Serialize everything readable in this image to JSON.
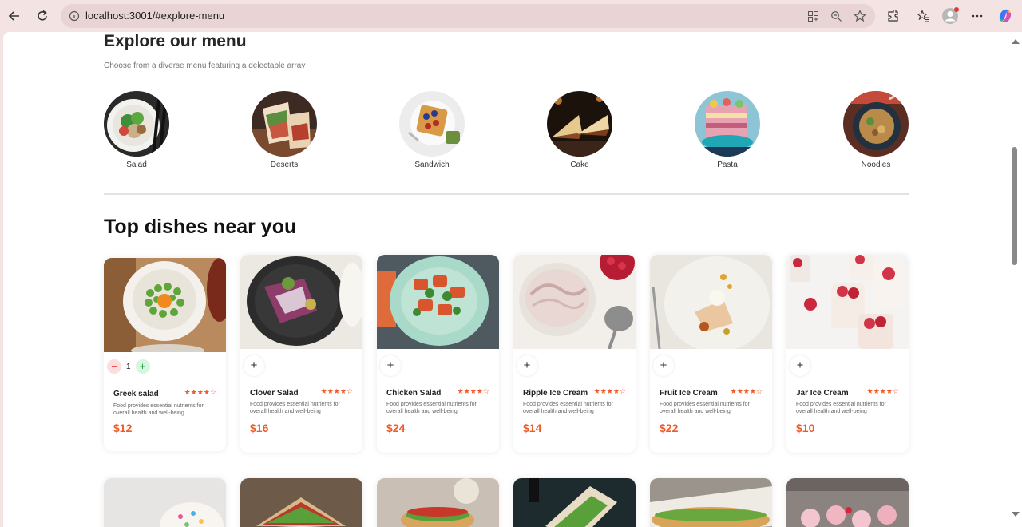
{
  "browser": {
    "url": "localhost:3001/#explore-menu"
  },
  "explore": {
    "title": "Explore our menu",
    "subtitle": "Choose from a diverse menu featuring a delectable array",
    "categories": [
      {
        "label": "Salad"
      },
      {
        "label": "Deserts"
      },
      {
        "label": "Sandwich"
      },
      {
        "label": "Cake"
      },
      {
        "label": "Pasta"
      },
      {
        "label": "Noodles"
      }
    ]
  },
  "dishes": {
    "title": "Top dishes near you",
    "items": [
      {
        "name": "Greek salad",
        "desc": "Food provides essential nutrients for overall health and well-being",
        "price": "$12",
        "qty": "1",
        "rating": 4
      },
      {
        "name": "Clover Salad",
        "desc": "Food provides essential nutrients for overall health and well-being",
        "price": "$16",
        "rating": 4
      },
      {
        "name": "Chicken Salad",
        "desc": "Food provides essential nutrients for overall health and well-being",
        "price": "$24",
        "rating": 4
      },
      {
        "name": "Ripple Ice Cream",
        "desc": "Food provides essential nutrients for overall health and well-being",
        "price": "$14",
        "rating": 4
      },
      {
        "name": "Fruit Ice Cream",
        "desc": "Food provides essential nutrients for overall health and well-being",
        "price": "$22",
        "rating": 4
      },
      {
        "name": "Jar Ice Cream",
        "desc": "Food provides essential nutrients for overall health and well-being",
        "price": "$10",
        "rating": 4
      }
    ]
  },
  "card_controls": {
    "add": "+",
    "minus": "−",
    "plus": "+"
  },
  "colors": {
    "accent": "#f05a28",
    "minus_bg": "#fcdede",
    "plus_bg": "#d7f6df"
  }
}
